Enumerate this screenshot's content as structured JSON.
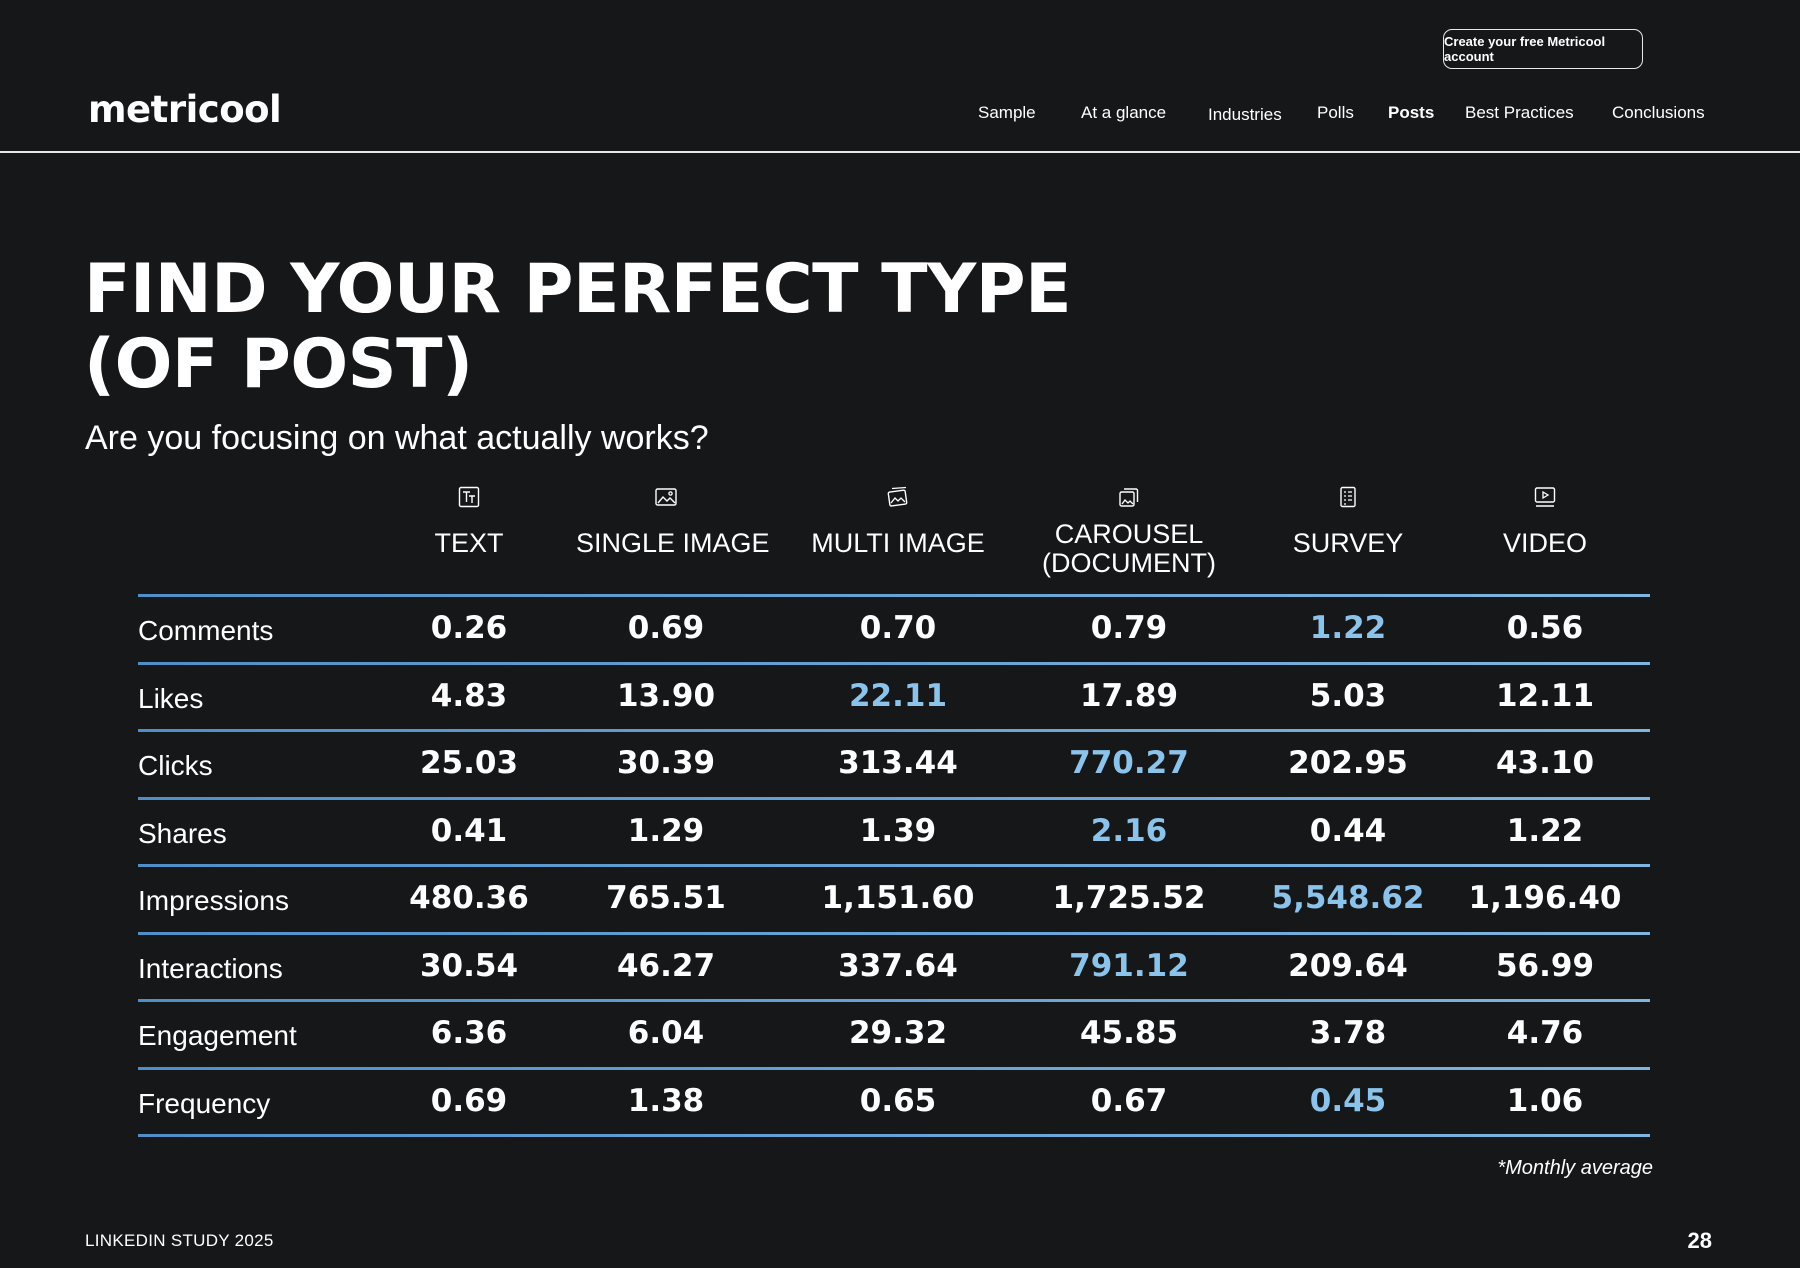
{
  "header": {
    "cta_label": "Create your free Metricool account",
    "logo_text": "metricool",
    "nav": [
      {
        "label": "Sample",
        "active": false
      },
      {
        "label": "At a glance",
        "active": false
      },
      {
        "label": "Industries",
        "active": false
      },
      {
        "label": "Polls",
        "active": false
      },
      {
        "label": "Posts",
        "active": true
      },
      {
        "label": "Best Practices",
        "active": false
      },
      {
        "label": "Conclusions",
        "active": false
      }
    ]
  },
  "main": {
    "title_line1": "FIND YOUR PERFECT TYPE",
    "title_line2": "(OF POST)",
    "subtitle": "Are you focusing on what actually works?"
  },
  "table": {
    "columns": [
      {
        "label": "TEXT",
        "icon": "text-icon"
      },
      {
        "label": "SINGLE IMAGE",
        "icon": "image-icon"
      },
      {
        "label": "MULTI IMAGE",
        "icon": "multi-image-icon"
      },
      {
        "label": "CAROUSEL (DOCUMENT)",
        "label_line1": "CAROUSEL",
        "label_line2": "(DOCUMENT)",
        "icon": "carousel-icon"
      },
      {
        "label": "SURVEY",
        "icon": "survey-icon"
      },
      {
        "label": "VIDEO",
        "icon": "video-icon"
      }
    ],
    "rows": [
      {
        "label": "Comments",
        "values": [
          "0.26",
          "0.69",
          "0.70",
          "0.79",
          "1.22",
          "0.56"
        ],
        "highlight": 4
      },
      {
        "label": "Likes",
        "values": [
          "4.83",
          "13.90",
          "22.11",
          "17.89",
          "5.03",
          "12.11"
        ],
        "highlight": 2
      },
      {
        "label": "Clicks",
        "values": [
          "25.03",
          "30.39",
          "313.44",
          "770.27",
          "202.95",
          "43.10"
        ],
        "highlight": 3
      },
      {
        "label": "Shares",
        "values": [
          "0.41",
          "1.29",
          "1.39",
          "2.16",
          "0.44",
          "1.22"
        ],
        "highlight": 3
      },
      {
        "label": "Impressions",
        "values": [
          "480.36",
          "765.51",
          "1,151.60",
          "1,725.52",
          "5,548.62",
          "1,196.40"
        ],
        "highlight": 4
      },
      {
        "label": "Interactions",
        "values": [
          "30.54",
          "46.27",
          "337.64",
          "791.12",
          "209.64",
          "56.99"
        ],
        "highlight": 3
      },
      {
        "label": "Engagement",
        "values": [
          "6.36",
          "6.04",
          "29.32",
          "45.85",
          "3.78",
          "4.76"
        ],
        "highlight": null
      },
      {
        "label": "Frequency",
        "values": [
          "0.69",
          "1.38",
          "0.65",
          "0.67",
          "0.45",
          "1.06"
        ],
        "highlight": 4
      }
    ],
    "highlight_color": "#8cc3ea",
    "rule_color": "#5d9bd1"
  },
  "footnote": "*Monthly average",
  "footer": {
    "study": "LINKEDIN STUDY 2025",
    "page_number": "28"
  }
}
